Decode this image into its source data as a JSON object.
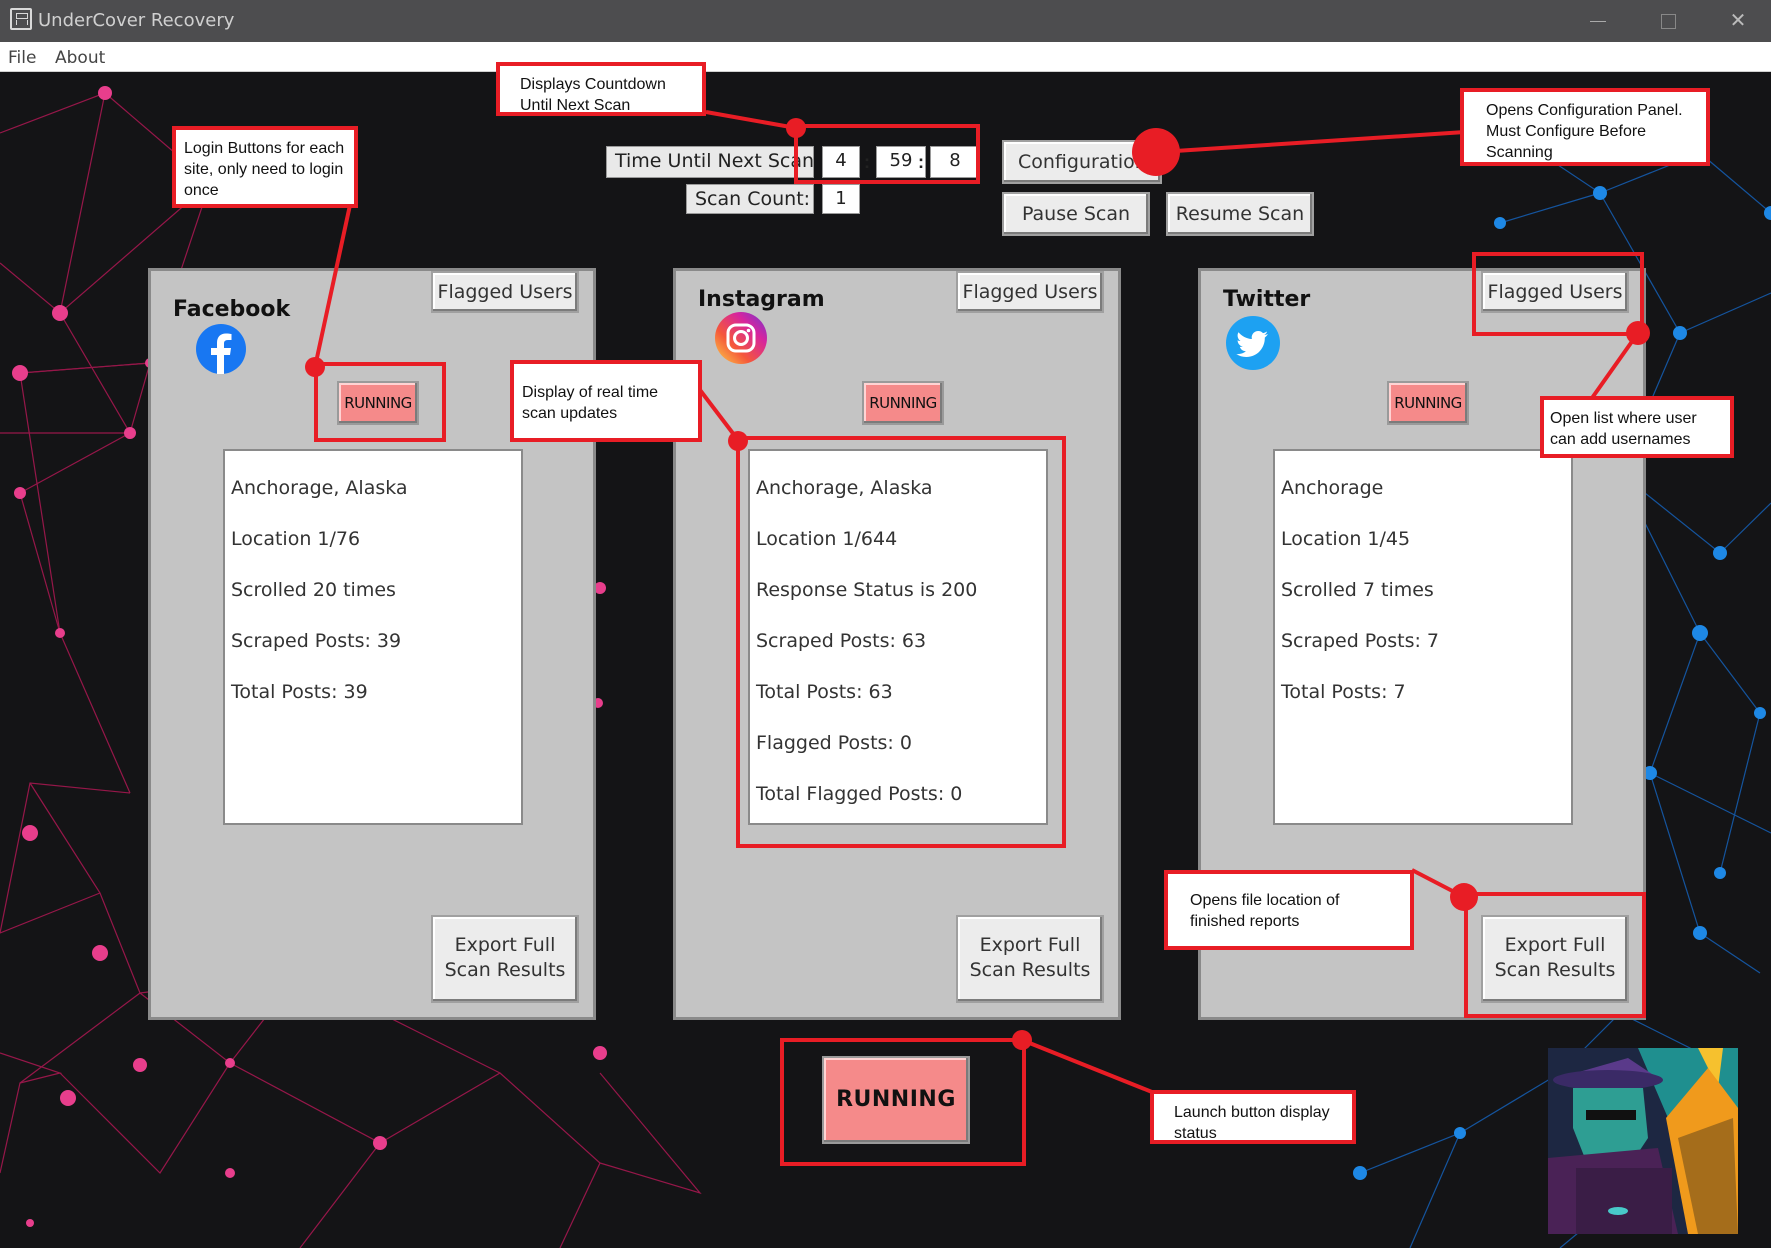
{
  "window": {
    "title": "UnderCover Recovery",
    "close_glyph": "✕"
  },
  "menu": [
    "File",
    "About"
  ],
  "scan": {
    "time_label": "Time Until Next Scan:",
    "hours": "4",
    "minutes": "59",
    "seconds": "8",
    "count_label": "Scan Count:",
    "count": "1"
  },
  "toolbar": {
    "configuration": "Configuration",
    "pause": "Pause Scan",
    "resume": "Resume Scan"
  },
  "panels": [
    {
      "title": "Facebook",
      "icon": "facebook-icon",
      "flagged_label": "Flagged Users",
      "status": "RUNNING",
      "log": [
        "Anchorage, Alaska",
        "Location 1/76",
        "Scrolled 20 times",
        "Scraped Posts: 39",
        "Total Posts: 39"
      ],
      "export_line1": "Export Full",
      "export_line2": "Scan Results"
    },
    {
      "title": "Instagram",
      "icon": "instagram-icon",
      "flagged_label": "Flagged Users",
      "status": "RUNNING",
      "log": [
        "Anchorage, Alaska",
        "Location 1/644",
        "Response Status is 200",
        "Scraped Posts: 63",
        "Total Posts: 63",
        "Flagged Posts: 0",
        "Total Flagged Posts: 0"
      ],
      "export_line1": "Export Full",
      "export_line2": "Scan Results"
    },
    {
      "title": "Twitter",
      "icon": "twitter-icon",
      "flagged_label": "Flagged Users",
      "status": "RUNNING",
      "log": [
        "Anchorage",
        "Location 1/45",
        "Scrolled 7 times",
        "Scraped Posts: 7",
        "Total Posts: 7"
      ],
      "export_line1": "Export Full",
      "export_line2": "Scan Results"
    }
  ],
  "launch": {
    "status": "RUNNING"
  },
  "annotations": {
    "countdown": "Displays Countdown Until Next Scan",
    "login": "Login Buttons for each site, only need to login once",
    "config": "Opens Configuration Panel. Must Configure Before Scanning",
    "realtime": "Display of real time scan updates",
    "flagged": "Open list where user can add usernames",
    "export": "Opens file location of finished reports",
    "launch": "Launch button display status"
  },
  "colors": {
    "accent_red": "#e81d25",
    "running": "#f58a8a",
    "panel_bg": "#c4c4c4",
    "background": "#141416"
  },
  "avatar_icon": "detective-avatar"
}
